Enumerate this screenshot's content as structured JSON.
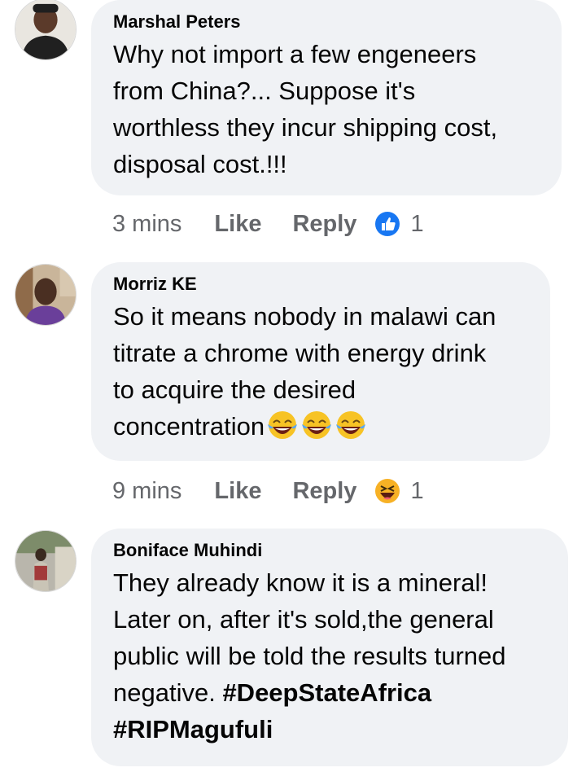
{
  "comments": [
    {
      "author": "Marshal Peters",
      "text": "Why not import a few engeneers\nfrom China?... Suppose it's\nworthless they incur shipping cost,\ndisposal cost.!!!",
      "time": "3 mins",
      "like_label": "Like",
      "reply_label": "Reply",
      "reaction": "like-icon",
      "reaction_count": "1"
    },
    {
      "author": "Morriz KE",
      "text": "So it means nobody in malawi can\ntitrate a chrome with energy drink\nto acquire the desired\nconcentration",
      "emoji": [
        "laughing-crying-emoji",
        "laughing-crying-emoji",
        "laughing-crying-emoji"
      ],
      "time": "9 mins",
      "like_label": "Like",
      "reply_label": "Reply",
      "reaction": "haha-icon",
      "reaction_count": "1"
    },
    {
      "author": "Boniface Muhindi",
      "text": "They already know it is a mineral!\nLater on, after it's sold,the general\npublic will be told the results turned\nnegative. ",
      "hashtags": [
        "#DeepStateAfrica",
        "#RIPMagufuli"
      ]
    }
  ],
  "colors": {
    "bubble": "#f0f2f5",
    "meta_text": "#65676b",
    "like_blue": "#1877f2",
    "haha_yellow": "#f7b125"
  }
}
